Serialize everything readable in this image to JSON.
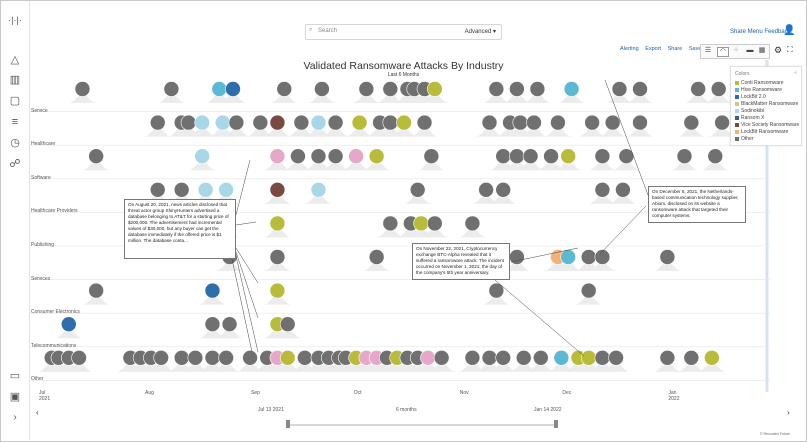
{
  "nav": {
    "logo": "·|·|·",
    "icons": [
      "alert-icon",
      "chart-icon",
      "report-icon",
      "list-icon",
      "clock-icon",
      "users-icon",
      "message-icon",
      "briefcase-icon",
      "chevron-right-icon"
    ]
  },
  "topbar": {
    "search_placeholder": "Search",
    "advanced_label": "Advanced",
    "share_menu_label": "Share Menu Feedback"
  },
  "toolbar": {
    "alerting": "Alerting",
    "export": "Export",
    "share": "Share",
    "save": "Save"
  },
  "chart_data": {
    "type": "scatter",
    "title": "Validated Ransomware Attacks By Industry",
    "subtitle": "Last 6 Months",
    "categories": [
      "Service",
      "Healthcare",
      "Software",
      "Healthcare Providers",
      "Publishing",
      "Services",
      "Consumer Electronics",
      "Telecommunications",
      "Other"
    ],
    "x_ticks": [
      {
        "label": "Jul",
        "sub": "2021",
        "date": "2021-07-01"
      },
      {
        "label": "Aug",
        "sub": "",
        "date": "2021-08-01"
      },
      {
        "label": "Sep",
        "sub": "",
        "date": "2021-09-01"
      },
      {
        "label": "Oct",
        "sub": "",
        "date": "2021-10-01"
      },
      {
        "label": "Nov",
        "sub": "",
        "date": "2021-11-01"
      },
      {
        "label": "Dec",
        "sub": "",
        "date": "2021-12-01"
      },
      {
        "label": "Jan",
        "sub": "2022",
        "date": "2022-01-01"
      }
    ],
    "xlim": [
      "2021-07-01",
      "2022-01-31"
    ],
    "legend_title": "Colors",
    "legend": [
      {
        "name": "Conti Ransomware",
        "color": "#b8bc3a"
      },
      {
        "name": "Hive Ransomware",
        "color": "#5bb9d4"
      },
      {
        "name": "LockBit 2.0",
        "color": "#2e6eac"
      },
      {
        "name": "BlackMatter Ransomware",
        "color": "#c9cc80"
      },
      {
        "name": "Sodinokibi",
        "color": "#a8d8e8"
      },
      {
        "name": "Ransom X",
        "color": "#3d5d8c"
      },
      {
        "name": "Vice Society Ransomware",
        "color": "#7a4a40"
      },
      {
        "name": "LockBit Ransomware",
        "color": "#f2b27a"
      },
      {
        "name": "Other",
        "color": "#707070"
      }
    ],
    "legend_placement": "top-right",
    "series_rows": [
      {
        "category": "Service",
        "points": [
          {
            "date": "2021-07-14",
            "color": "#707070"
          },
          {
            "date": "2021-08-09",
            "color": "#707070"
          },
          {
            "date": "2021-08-23",
            "color": "#5bb9d4"
          },
          {
            "date": "2021-08-27",
            "color": "#2e6eac"
          },
          {
            "date": "2021-09-11",
            "color": "#707070"
          },
          {
            "date": "2021-09-22",
            "color": "#707070"
          },
          {
            "date": "2021-10-05",
            "color": "#707070"
          },
          {
            "date": "2021-10-12",
            "color": "#707070"
          },
          {
            "date": "2021-10-17",
            "color": "#707070"
          },
          {
            "date": "2021-10-19",
            "color": "#707070"
          },
          {
            "date": "2021-10-22",
            "color": "#707070"
          },
          {
            "date": "2021-10-25",
            "color": "#b8bc3a"
          },
          {
            "date": "2021-11-12",
            "color": "#707070"
          },
          {
            "date": "2021-11-18",
            "color": "#707070"
          },
          {
            "date": "2021-11-24",
            "color": "#707070"
          },
          {
            "date": "2021-12-04",
            "color": "#5bb9d4"
          },
          {
            "date": "2021-12-18",
            "color": "#707070"
          },
          {
            "date": "2021-12-24",
            "color": "#707070"
          },
          {
            "date": "2022-01-10",
            "color": "#707070"
          },
          {
            "date": "2022-01-16",
            "color": "#707070"
          }
        ]
      },
      {
        "category": "Healthcare",
        "points": [
          {
            "date": "2021-08-05",
            "color": "#707070"
          },
          {
            "date": "2021-08-12",
            "color": "#707070"
          },
          {
            "date": "2021-08-14",
            "color": "#707070"
          },
          {
            "date": "2021-08-18",
            "color": "#a8d8e8"
          },
          {
            "date": "2021-08-24",
            "color": "#a8d8e8"
          },
          {
            "date": "2021-08-28",
            "color": "#707070"
          },
          {
            "date": "2021-09-04",
            "color": "#707070"
          },
          {
            "date": "2021-09-09",
            "color": "#7a4a40"
          },
          {
            "date": "2021-09-16",
            "color": "#707070"
          },
          {
            "date": "2021-09-21",
            "color": "#a8d8e8"
          },
          {
            "date": "2021-09-26",
            "color": "#707070"
          },
          {
            "date": "2021-10-03",
            "color": "#b8bc3a"
          },
          {
            "date": "2021-10-09",
            "color": "#707070"
          },
          {
            "date": "2021-10-12",
            "color": "#707070"
          },
          {
            "date": "2021-10-16",
            "color": "#b8bc3a"
          },
          {
            "date": "2021-10-22",
            "color": "#707070"
          },
          {
            "date": "2021-11-10",
            "color": "#707070"
          },
          {
            "date": "2021-11-16",
            "color": "#707070"
          },
          {
            "date": "2021-11-19",
            "color": "#707070"
          },
          {
            "date": "2021-11-23",
            "color": "#707070"
          },
          {
            "date": "2021-11-30",
            "color": "#707070"
          },
          {
            "date": "2021-12-10",
            "color": "#707070"
          },
          {
            "date": "2021-12-16",
            "color": "#707070"
          },
          {
            "date": "2021-12-24",
            "color": "#707070"
          },
          {
            "date": "2022-01-08",
            "color": "#707070"
          },
          {
            "date": "2022-01-17",
            "color": "#707070"
          }
        ]
      },
      {
        "category": "Software",
        "points": [
          {
            "date": "2021-07-18",
            "color": "#707070"
          },
          {
            "date": "2021-08-18",
            "color": "#a8d8e8"
          },
          {
            "date": "2021-09-09",
            "color": "#e6a8c8"
          },
          {
            "date": "2021-09-15",
            "color": "#707070"
          },
          {
            "date": "2021-09-21",
            "color": "#707070"
          },
          {
            "date": "2021-09-26",
            "color": "#707070"
          },
          {
            "date": "2021-10-02",
            "color": "#e6a8c8"
          },
          {
            "date": "2021-10-08",
            "color": "#b8bc3a"
          },
          {
            "date": "2021-10-24",
            "color": "#707070"
          },
          {
            "date": "2021-11-14",
            "color": "#707070"
          },
          {
            "date": "2021-11-18",
            "color": "#707070"
          },
          {
            "date": "2021-11-22",
            "color": "#707070"
          },
          {
            "date": "2021-11-28",
            "color": "#707070"
          },
          {
            "date": "2021-12-03",
            "color": "#b8bc3a"
          },
          {
            "date": "2021-12-13",
            "color": "#707070"
          },
          {
            "date": "2021-12-20",
            "color": "#707070"
          },
          {
            "date": "2022-01-06",
            "color": "#707070"
          },
          {
            "date": "2022-01-15",
            "color": "#707070"
          }
        ]
      },
      {
        "category": "Healthcare Providers",
        "points": [
          {
            "date": "2021-08-05",
            "color": "#707070"
          },
          {
            "date": "2021-08-12",
            "color": "#707070"
          },
          {
            "date": "2021-08-19",
            "color": "#a8d8e8"
          },
          {
            "date": "2021-08-25",
            "color": "#a8d8e8"
          },
          {
            "date": "2021-09-09",
            "color": "#7a4a40"
          },
          {
            "date": "2021-09-21",
            "color": "#a8d8e8"
          },
          {
            "date": "2021-10-20",
            "color": "#707070"
          },
          {
            "date": "2021-11-09",
            "color": "#707070"
          },
          {
            "date": "2021-11-14",
            "color": "#707070"
          },
          {
            "date": "2021-12-13",
            "color": "#707070"
          },
          {
            "date": "2021-12-19",
            "color": "#707070"
          }
        ]
      },
      {
        "category": "Publishing",
        "points": [
          {
            "date": "2021-08-05",
            "color": "#707070"
          },
          {
            "date": "2021-08-12",
            "color": "#707070"
          },
          {
            "date": "2021-08-25",
            "color": "#707070"
          },
          {
            "date": "2021-09-09",
            "color": "#b8bc3a"
          },
          {
            "date": "2021-10-12",
            "color": "#707070"
          },
          {
            "date": "2021-10-18",
            "color": "#707070"
          },
          {
            "date": "2021-10-21",
            "color": "#b8bc3a"
          },
          {
            "date": "2021-10-25",
            "color": "#707070"
          },
          {
            "date": "2021-11-05",
            "color": "#707070"
          }
        ]
      },
      {
        "category": "Services",
        "points": [
          {
            "date": "2021-08-26",
            "color": "#707070"
          },
          {
            "date": "2021-09-09",
            "color": "#707070"
          },
          {
            "date": "2021-10-08",
            "color": "#707070"
          },
          {
            "date": "2021-11-18",
            "color": "#707070"
          },
          {
            "date": "2021-11-30",
            "color": "#f2b27a"
          },
          {
            "date": "2021-12-03",
            "color": "#5bb9d4"
          },
          {
            "date": "2021-12-09",
            "color": "#707070"
          },
          {
            "date": "2021-12-13",
            "color": "#707070"
          },
          {
            "date": "2022-01-01",
            "color": "#707070"
          }
        ]
      },
      {
        "category": "Consumer Electronics",
        "points": [
          {
            "date": "2021-07-18",
            "color": "#707070"
          },
          {
            "date": "2021-08-21",
            "color": "#2e6eac"
          },
          {
            "date": "2021-09-09",
            "color": "#b8bc3a"
          },
          {
            "date": "2021-11-12",
            "color": "#707070"
          },
          {
            "date": "2021-12-09",
            "color": "#707070"
          }
        ]
      },
      {
        "category": "Telecommunications",
        "points": [
          {
            "date": "2021-07-10",
            "color": "#2e6eac"
          },
          {
            "date": "2021-08-21",
            "color": "#707070"
          },
          {
            "date": "2021-08-26",
            "color": "#707070"
          },
          {
            "date": "2021-09-09",
            "color": "#b8bc3a"
          },
          {
            "date": "2021-09-12",
            "color": "#707070"
          }
        ]
      },
      {
        "category": "Other",
        "points": [
          {
            "date": "2021-07-05",
            "color": "#707070"
          },
          {
            "date": "2021-07-07",
            "color": "#707070"
          },
          {
            "date": "2021-07-10",
            "color": "#707070"
          },
          {
            "date": "2021-07-13",
            "color": "#707070"
          },
          {
            "date": "2021-07-28",
            "color": "#707070"
          },
          {
            "date": "2021-07-31",
            "color": "#707070"
          },
          {
            "date": "2021-08-03",
            "color": "#707070"
          },
          {
            "date": "2021-08-06",
            "color": "#707070"
          },
          {
            "date": "2021-08-12",
            "color": "#707070"
          },
          {
            "date": "2021-08-16",
            "color": "#707070"
          },
          {
            "date": "2021-08-21",
            "color": "#707070"
          },
          {
            "date": "2021-08-25",
            "color": "#707070"
          },
          {
            "date": "2021-09-01",
            "color": "#707070"
          },
          {
            "date": "2021-09-06",
            "color": "#707070"
          },
          {
            "date": "2021-09-09",
            "color": "#e6a8c8"
          },
          {
            "date": "2021-09-12",
            "color": "#b8bc3a"
          },
          {
            "date": "2021-09-17",
            "color": "#707070"
          },
          {
            "date": "2021-09-21",
            "color": "#707070"
          },
          {
            "date": "2021-09-24",
            "color": "#707070"
          },
          {
            "date": "2021-09-27",
            "color": "#707070"
          },
          {
            "date": "2021-09-29",
            "color": "#707070"
          },
          {
            "date": "2021-10-02",
            "color": "#b8bc3a"
          },
          {
            "date": "2021-10-05",
            "color": "#e6a8c8"
          },
          {
            "date": "2021-10-08",
            "color": "#e6a8c8"
          },
          {
            "date": "2021-10-11",
            "color": "#707070"
          },
          {
            "date": "2021-10-14",
            "color": "#b8bc3a"
          },
          {
            "date": "2021-10-17",
            "color": "#707070"
          },
          {
            "date": "2021-10-20",
            "color": "#707070"
          },
          {
            "date": "2021-10-23",
            "color": "#e6a8c8"
          },
          {
            "date": "2021-10-27",
            "color": "#707070"
          },
          {
            "date": "2021-11-05",
            "color": "#707070"
          },
          {
            "date": "2021-11-10",
            "color": "#707070"
          },
          {
            "date": "2021-11-14",
            "color": "#707070"
          },
          {
            "date": "2021-11-20",
            "color": "#707070"
          },
          {
            "date": "2021-11-25",
            "color": "#707070"
          },
          {
            "date": "2021-12-01",
            "color": "#5bb9d4"
          },
          {
            "date": "2021-12-06",
            "color": "#b8bc3a"
          },
          {
            "date": "2021-12-09",
            "color": "#b8bc3a"
          },
          {
            "date": "2021-12-13",
            "color": "#707070"
          },
          {
            "date": "2021-12-17",
            "color": "#707070"
          },
          {
            "date": "2022-01-01",
            "color": "#707070"
          },
          {
            "date": "2022-01-08",
            "color": "#707070"
          },
          {
            "date": "2022-01-14",
            "color": "#b8bc3a"
          }
        ]
      }
    ],
    "annotations": [
      {
        "text": "On August 20, 2021, news articles disclosed that threat actor group ShinyHunters advertised a database belonging to AT&T for a starting price of $200,000. The advertisement had incremental values of $30,000, but any buyer can get the database immediately if the offered price is $1 million. The database conta..."
      },
      {
        "text": "On December 6, 2021, the Netherlands-based communication technology supplier, Abiom, disclosed on its website a ransomware attack that targeted their computer systems."
      },
      {
        "text": "On November 22, 2021, Cryptocurrency exchange BTC-Alpha revealed that it suffered a ransomware attack. The incident occurred on November 1, 2021, the day of the company's 5th year anniversary."
      }
    ]
  },
  "range": {
    "start_label": "Jul 13 2021",
    "span_label": "6 months",
    "end_label": "Jan 14 2022"
  },
  "credit": "© Recorded Future"
}
